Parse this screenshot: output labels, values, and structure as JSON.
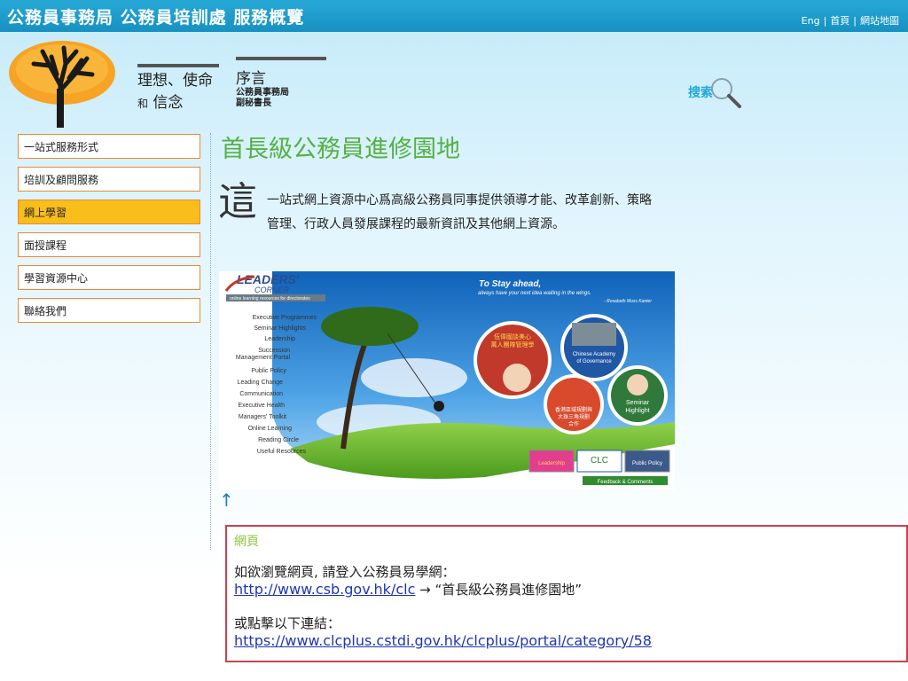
{
  "header": {
    "site_title": "公務員事務局 公務員培訓處 服務概覽",
    "links": [
      "Eng",
      "首頁",
      "網站地圖"
    ]
  },
  "tagline": {
    "line1": "理想、使命",
    "line2_small": "和",
    "line2": "信念",
    "preface_title": "序言",
    "preface_sub1": "公務員事務局",
    "preface_sub2": "副秘書長"
  },
  "search": {
    "label": "搜索"
  },
  "sidebar": {
    "items": [
      {
        "label": "一站式服務形式"
      },
      {
        "label": "培訓及顧問服務"
      },
      {
        "label": "網上學習"
      },
      {
        "label": "面授課程"
      },
      {
        "label": "學習資源中心"
      },
      {
        "label": "聯絡我們"
      }
    ]
  },
  "main": {
    "title": "首長級公務員進修園地",
    "intro_big_char": "這",
    "intro_line1": "一站式網上資源中心爲高級公務員同事提供領導才能、改革創新、策略",
    "intro_line2": "管理、行政人員發展課程的最新資訊及其他網上資源。",
    "back_to_top": "↑"
  },
  "banner": {
    "logo_main": "LEADERS'",
    "logo_sub": "CORNER",
    "logo_strap": "online learning resources for directorates",
    "menu": [
      "Executive Programmes",
      "Seminar Highlights",
      "Leadership",
      "Succession",
      "Management Portal",
      "Public Policy",
      "Leading Change",
      "Communication",
      "Executive Health",
      "Managers' Toolkit",
      "Online Learning",
      "Reading Circle",
      "Useful Resources"
    ],
    "headline": "To Stay ahead,",
    "subline": "always have your next idea waiting in the wings.",
    "quote": "- Rosabeth Moss Kanter",
    "circle1": "伍偉國談美心\n萬人團隊管理學",
    "circle2": "Chinese Academy\nof Governance",
    "circle3": "香港區域規劃與\n大珠三角規劃\n合作",
    "circle4": "Seminar\nHighlight",
    "btn1": "Leadership",
    "btn2": "CLC",
    "btn3": "Public Policy",
    "feedback": "Feedback & Comments"
  },
  "notice": {
    "heading": "網頁",
    "line1": "如欲瀏覽網頁, 請登入公務員易學網：",
    "link1": "http://www.csb.gov.hk/clc",
    "link1_suffix": " → “首長級公務員進修園地”",
    "line2": "或點擊以下連結：",
    "link2": "https://www.clcplus.cstdi.gov.hk/clcplus/portal/category/58"
  },
  "colors": {
    "topbar": "#1a9cd0",
    "title_green": "#55b144",
    "active_nav": "#f9bd1c",
    "nav_border": "#e8893a",
    "notice_border": "#c7434f",
    "link": "#1f35b3"
  }
}
